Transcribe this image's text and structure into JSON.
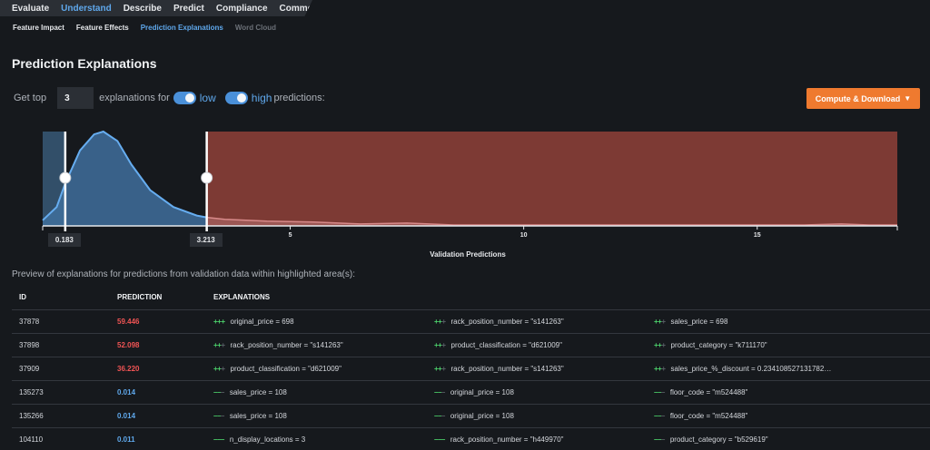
{
  "topnav": [
    {
      "label": "Evaluate",
      "active": false
    },
    {
      "label": "Understand",
      "active": true
    },
    {
      "label": "Describe",
      "active": false
    },
    {
      "label": "Predict",
      "active": false
    },
    {
      "label": "Compliance",
      "active": false
    },
    {
      "label": "Comments",
      "active": false
    }
  ],
  "subnav": [
    {
      "label": "Feature Impact",
      "state": "normal"
    },
    {
      "label": "Feature Effects",
      "state": "normal"
    },
    {
      "label": "Prediction Explanations",
      "state": "active"
    },
    {
      "label": "Word Cloud",
      "state": "disabled"
    }
  ],
  "page_title": "Prediction Explanations",
  "controls": {
    "get_top": "Get top",
    "top_n": "3",
    "explanations_for": "explanations for",
    "low_label": "low",
    "high_label": "high",
    "predictions": "predictions:",
    "low_enabled": true,
    "high_enabled": true
  },
  "compute_button": "Compute & Download",
  "chart_data": {
    "type": "area",
    "xlabel": "Validation Predictions",
    "xlim": [
      -0.3,
      18.0
    ],
    "x_ticks": [
      5,
      10,
      15
    ],
    "low_threshold": "0.183",
    "high_threshold": "3.213",
    "low_value": 0.183,
    "high_value": 3.213,
    "low_color": "#4a7ba8",
    "high_color": "#a0463c",
    "distribution": {
      "x": [
        -0.3,
        0.0,
        0.183,
        0.5,
        0.8,
        1.0,
        1.3,
        1.6,
        2.0,
        2.5,
        3.0,
        3.213,
        3.6,
        4.5,
        5.5,
        6.5,
        7.5,
        8.5,
        10,
        12,
        14,
        16,
        16.8,
        17.4,
        18.0
      ],
      "y": [
        0.06,
        0.2,
        0.45,
        0.8,
        0.97,
        1.0,
        0.9,
        0.65,
        0.38,
        0.2,
        0.11,
        0.09,
        0.07,
        0.05,
        0.04,
        0.02,
        0.03,
        0.01,
        0.01,
        0.01,
        0.01,
        0.01,
        0.02,
        0.01,
        0.01
      ]
    }
  },
  "preview_text": "Preview of explanations for predictions from validation data within highlighted area(s):",
  "table": {
    "headers": [
      "ID",
      "PREDICTION",
      "EXPLANATIONS"
    ],
    "rows": [
      {
        "id": "37878",
        "prediction": "59.446",
        "level": "hi",
        "explanations": [
          {
            "strength": "+++",
            "text": "original_price = 698"
          },
          {
            "strength": "++",
            "text": "rack_position_number = \"s141263\""
          },
          {
            "strength": "++",
            "text": "sales_price = 698"
          }
        ]
      },
      {
        "id": "37898",
        "prediction": "52.098",
        "level": "hi",
        "explanations": [
          {
            "strength": "++",
            "text": "rack_position_number = \"s141263\""
          },
          {
            "strength": "++",
            "text": "product_classification = \"d621009\""
          },
          {
            "strength": "++",
            "text": "product_category = \"k711170\""
          }
        ]
      },
      {
        "id": "37909",
        "prediction": "36.220",
        "level": "hi",
        "explanations": [
          {
            "strength": "++",
            "text": "product_classification = \"d621009\""
          },
          {
            "strength": "++",
            "text": "rack_position_number = \"s141263\""
          },
          {
            "strength": "++",
            "text": "sales_price_%_discount = 0.234108527131782…"
          }
        ]
      },
      {
        "id": "135273",
        "prediction": "0.014",
        "level": "lo",
        "explanations": [
          {
            "strength": "--",
            "text": "sales_price = 108"
          },
          {
            "strength": "--",
            "text": "original_price = 108"
          },
          {
            "strength": "--",
            "text": "floor_code = \"m524488\""
          }
        ]
      },
      {
        "id": "135266",
        "prediction": "0.014",
        "level": "lo",
        "explanations": [
          {
            "strength": "--",
            "text": "sales_price = 108"
          },
          {
            "strength": "--",
            "text": "original_price = 108"
          },
          {
            "strength": "--",
            "text": "floor_code = \"m524488\""
          }
        ]
      },
      {
        "id": "104110",
        "prediction": "0.011",
        "level": "lo",
        "explanations": [
          {
            "strength": "---",
            "text": "n_display_locations = 3"
          },
          {
            "strength": "---",
            "text": "rack_position_number = \"h449970\""
          },
          {
            "strength": "--",
            "text": "product_category = \"b529619\""
          }
        ]
      }
    ]
  }
}
